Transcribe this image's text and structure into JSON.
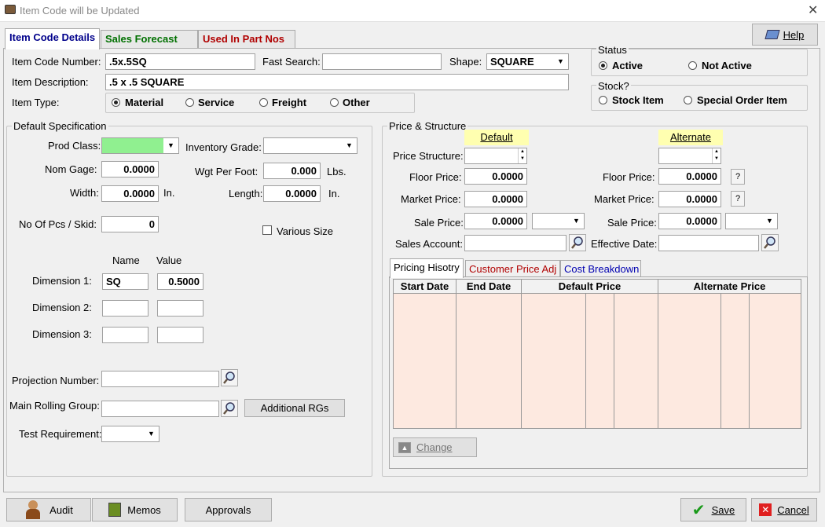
{
  "window": {
    "title": "Item Code will be Updated"
  },
  "tabs": [
    "Item Code Details",
    "Sales Forecast",
    "Used In Part Nos"
  ],
  "help_label": "Help",
  "header": {
    "item_code_label": "Item Code Number:",
    "item_code_value": ".5x.5SQ",
    "fast_search_label": "Fast Search:",
    "fast_search_value": "",
    "shape_label": "Shape:",
    "shape_value": "SQUARE",
    "description_label": "Item Description:",
    "description_value": ".5 x .5 SQUARE",
    "item_type_label": "Item Type:",
    "item_types": [
      "Material",
      "Service",
      "Freight",
      "Other"
    ],
    "item_type_selected": "Material"
  },
  "status": {
    "title": "Status",
    "options": [
      "Active",
      "Not Active"
    ],
    "selected": "Active"
  },
  "stock": {
    "title": "Stock?",
    "options": [
      "Stock Item",
      "Special Order Item"
    ],
    "selected": ""
  },
  "spec": {
    "title": "Default Specification",
    "prod_class_label": "Prod Class:",
    "inventory_grade_label": "Inventory Grade:",
    "nom_gage_label": "Nom Gage:",
    "nom_gage_value": "0.0000",
    "wgt_label": "Wgt Per Foot:",
    "wgt_value": "0.000",
    "wgt_unit": "Lbs.",
    "width_label": "Width:",
    "width_value": "0.0000",
    "width_unit": "In.",
    "length_label": "Length:",
    "length_value": "0.0000",
    "length_unit": "In.",
    "pcs_label": "No Of Pcs / Skid:",
    "pcs_value": "0",
    "various_size_label": "Various Size",
    "name_header": "Name",
    "value_header": "Value",
    "dimensions": [
      {
        "label": "Dimension 1:",
        "name": "SQ",
        "value": "0.5000"
      },
      {
        "label": "Dimension 2:",
        "name": "",
        "value": ""
      },
      {
        "label": "Dimension 3:",
        "name": "",
        "value": ""
      }
    ],
    "projection_label": "Projection Number:",
    "rolling_group_label": "Main Rolling Group:",
    "additional_rgs_label": "Additional RGs",
    "test_req_label": "Test Requirement:"
  },
  "price": {
    "title": "Price & Structure",
    "default_header": "Default",
    "alternate_header": "Alternate",
    "price_structure_label": "Price Structure:",
    "floor_label": "Floor Price:",
    "market_label": "Market Price:",
    "sale_label": "Sale Price:",
    "default_floor": "0.0000",
    "default_market": "0.0000",
    "default_sale": "0.0000",
    "alt_floor": "0.0000",
    "alt_market": "0.0000",
    "alt_sale": "0.0000",
    "sales_account_label": "Sales Account:",
    "effective_date_label": "Effective Date:",
    "question_mark": "?",
    "sub_tabs": [
      "Pricing Hisotry",
      "Customer Price Adj",
      "Cost Breakdown"
    ],
    "grid_headers": [
      "Start Date",
      "End Date",
      "Default Price",
      "Alternate Price"
    ],
    "change_label": "Change"
  },
  "footer": {
    "audit": "Audit",
    "memos": "Memos",
    "approvals": "Approvals",
    "save": "Save",
    "cancel": "Cancel"
  },
  "colors": {
    "grid_bg": "#fde9e0",
    "prod_class_bg": "#90f090",
    "highlight": "#ffffb0"
  }
}
